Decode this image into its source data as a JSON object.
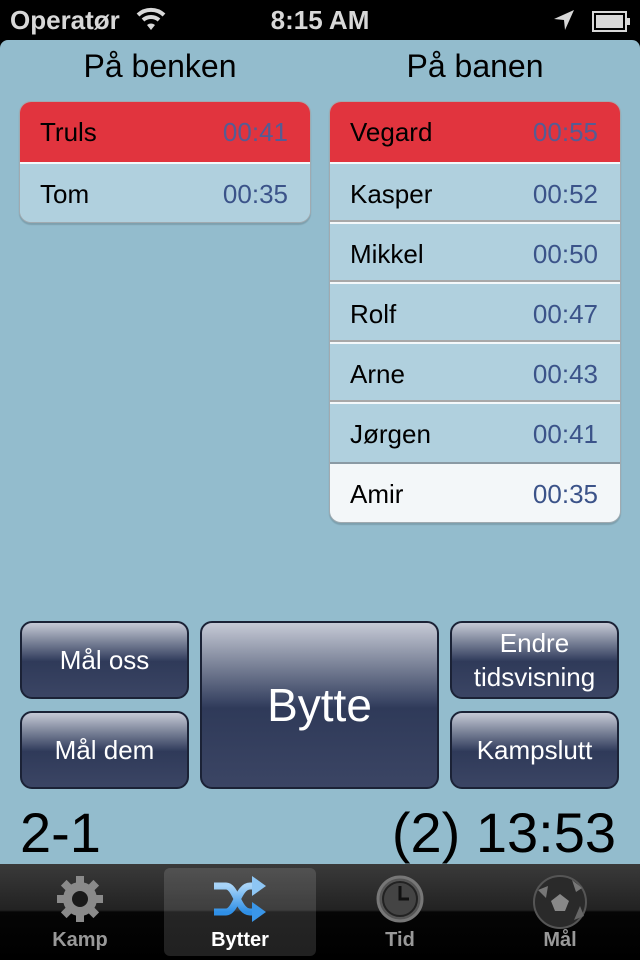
{
  "status_bar": {
    "carrier": "Operatør",
    "time": "8:15 AM",
    "icons": [
      "wifi-icon",
      "location-arrow-icon",
      "battery-icon"
    ]
  },
  "bench": {
    "title": "På benken",
    "players": [
      {
        "name": "Truls",
        "time": "00:41",
        "state": "highlighted"
      },
      {
        "name": "Tom",
        "time": "00:35",
        "state": "normal"
      }
    ]
  },
  "field": {
    "title": "På banen",
    "players": [
      {
        "name": "Vegard",
        "time": "00:55",
        "state": "highlighted"
      },
      {
        "name": "Kasper",
        "time": "00:52",
        "state": "normal"
      },
      {
        "name": "Mikkel",
        "time": "00:50",
        "state": "normal"
      },
      {
        "name": "Rolf",
        "time": "00:47",
        "state": "normal"
      },
      {
        "name": "Arne",
        "time": "00:43",
        "state": "normal"
      },
      {
        "name": "Jørgen",
        "time": "00:41",
        "state": "normal"
      },
      {
        "name": "Amir",
        "time": "00:35",
        "state": "selected"
      }
    ]
  },
  "buttons": {
    "goal_us": "Mål oss",
    "goal_them": "Mål dem",
    "substitute": "Bytte",
    "change_time_display_line1": "Endre",
    "change_time_display_line2": "tidsvisning",
    "end_match": "Kampslutt"
  },
  "scoreboard": {
    "score": "2-1",
    "period_and_clock": "(2) 13:53"
  },
  "tab_bar": {
    "active": "Bytter",
    "tabs": [
      {
        "label": "Kamp",
        "icon": "gear-icon"
      },
      {
        "label": "Bytter",
        "icon": "shuffle-icon"
      },
      {
        "label": "Tid",
        "icon": "clock-icon"
      },
      {
        "label": "Mål",
        "icon": "soccer-ball-icon"
      }
    ]
  },
  "colors": {
    "background": "#93bccd",
    "highlight_row": "#e1343e",
    "time_text": "#3b5389",
    "button_dark": "#2f3a59",
    "tab_active_icon": "#4aa8ee"
  }
}
